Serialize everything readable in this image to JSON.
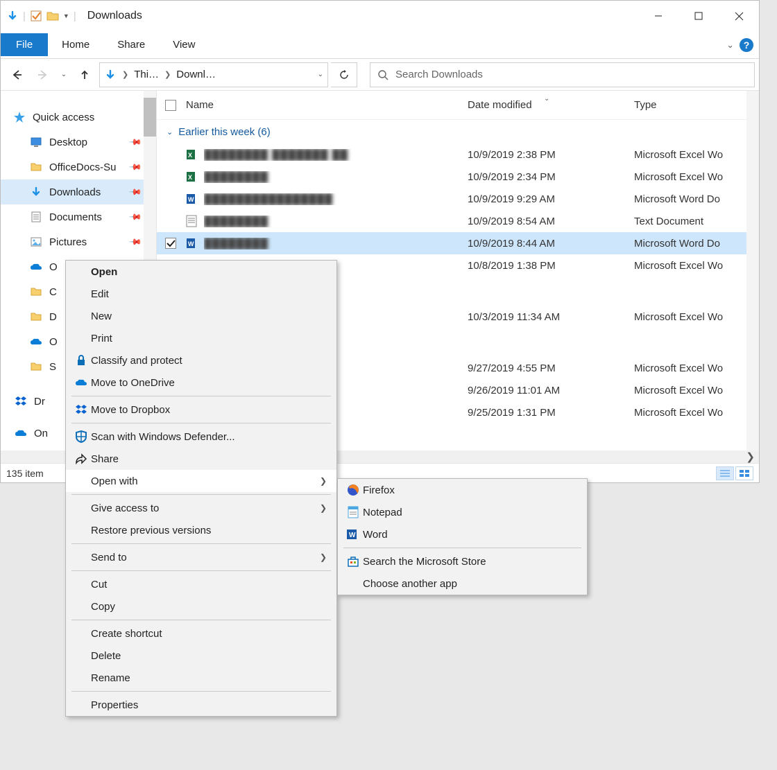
{
  "title": "Downloads",
  "ribbon": {
    "file": "File",
    "home": "Home",
    "share": "Share",
    "view": "View"
  },
  "address": {
    "crumb1": "Thi…",
    "crumb2": "Downl…"
  },
  "search": {
    "placeholder": "Search Downloads"
  },
  "sidebar": {
    "quick_access": "Quick access",
    "items": [
      {
        "label": "Desktop",
        "pinned": true
      },
      {
        "label": "OfficeDocs-Su",
        "pinned": true
      },
      {
        "label": "Downloads",
        "pinned": true,
        "selected": true
      },
      {
        "label": "Documents",
        "pinned": true
      },
      {
        "label": "Pictures",
        "pinned": true
      },
      {
        "label": "O"
      },
      {
        "label": "C"
      },
      {
        "label": "D"
      },
      {
        "label": "O"
      },
      {
        "label": "S"
      }
    ],
    "dropbox": "Dr",
    "onedrive": "On"
  },
  "columns": {
    "name": "Name",
    "date": "Date modified",
    "type": "Type"
  },
  "groups": [
    {
      "header": "Earlier this week (6)",
      "rows": [
        {
          "name_blur": "████████ ███████ ██",
          "date": "10/9/2019 2:38 PM",
          "type": "Microsoft Excel Wo",
          "icon": "excel"
        },
        {
          "name_blur": "████████",
          "date": "10/9/2019 2:34 PM",
          "type": "Microsoft Excel Wo",
          "icon": "excel"
        },
        {
          "name_blur": "████████████████",
          "date": "10/9/2019 9:29 AM",
          "type": "Microsoft Word Do",
          "icon": "word"
        },
        {
          "name_blur": "████████",
          "date": "10/9/2019 8:54 AM",
          "type": "Text Document",
          "icon": "text"
        },
        {
          "name_blur": "████████",
          "date": "10/9/2019 8:44 AM",
          "type": "Microsoft Word Do",
          "icon": "word",
          "selected": true,
          "checked": true
        },
        {
          "name_blur": "",
          "date": "10/8/2019 1:38 PM",
          "type": "Microsoft Excel Wo",
          "icon": "excel"
        }
      ]
    },
    {
      "header": "",
      "rows": [
        {
          "name_blur": "",
          "date": "10/3/2019 11:34 AM",
          "type": "Microsoft Excel Wo",
          "icon": "excel"
        }
      ]
    },
    {
      "header": "",
      "rows": [
        {
          "name_blur": "",
          "date": "9/27/2019 4:55 PM",
          "type": "Microsoft Excel Wo",
          "icon": "excel"
        },
        {
          "name_blur": "",
          "date": "9/26/2019 11:01 AM",
          "type": "Microsoft Excel Wo",
          "icon": "excel"
        },
        {
          "name_blur": "",
          "date": "9/25/2019 1:31 PM",
          "type": "Microsoft Excel Wo",
          "icon": "excel"
        }
      ]
    }
  ],
  "status": {
    "count": "135 item"
  },
  "context_menu": {
    "open": "Open",
    "edit": "Edit",
    "new": "New",
    "print": "Print",
    "classify": "Classify and protect",
    "onedrive": "Move to OneDrive",
    "dropbox": "Move to Dropbox",
    "defender": "Scan with Windows Defender...",
    "share": "Share",
    "open_with": "Open with",
    "give_access": "Give access to",
    "restore": "Restore previous versions",
    "send_to": "Send to",
    "cut": "Cut",
    "copy": "Copy",
    "shortcut": "Create shortcut",
    "delete": "Delete",
    "rename": "Rename",
    "properties": "Properties"
  },
  "submenu": {
    "firefox": "Firefox",
    "notepad": "Notepad",
    "word": "Word",
    "store": "Search the Microsoft Store",
    "choose": "Choose another app"
  }
}
